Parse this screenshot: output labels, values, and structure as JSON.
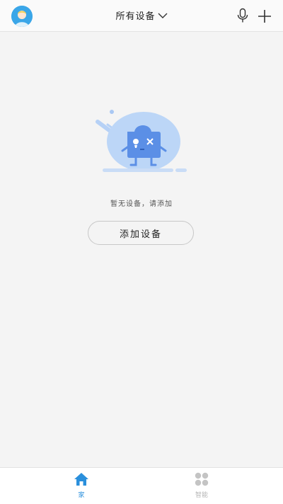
{
  "header": {
    "title": "所有设备",
    "title_dropdown_icon": "chevron-down-icon",
    "avatar_icon": "avatar-icon",
    "mic_icon": "microphone-icon",
    "add_icon": "plus-icon"
  },
  "main": {
    "illustration": "empty-device-illustration",
    "empty_message": "暂无设备，请添加",
    "add_device_label": "添加设备"
  },
  "tabbar": {
    "tabs": [
      {
        "label": "家",
        "icon": "home-icon",
        "active": true
      },
      {
        "label": "智能",
        "icon": "grid-icon",
        "active": false
      }
    ]
  },
  "colors": {
    "accent": "#2a8fdc",
    "inactive": "#b5b5b5",
    "background": "#f4f4f4",
    "illustration_light": "#bcd6f7",
    "illustration_dark": "#5b8fe6"
  }
}
